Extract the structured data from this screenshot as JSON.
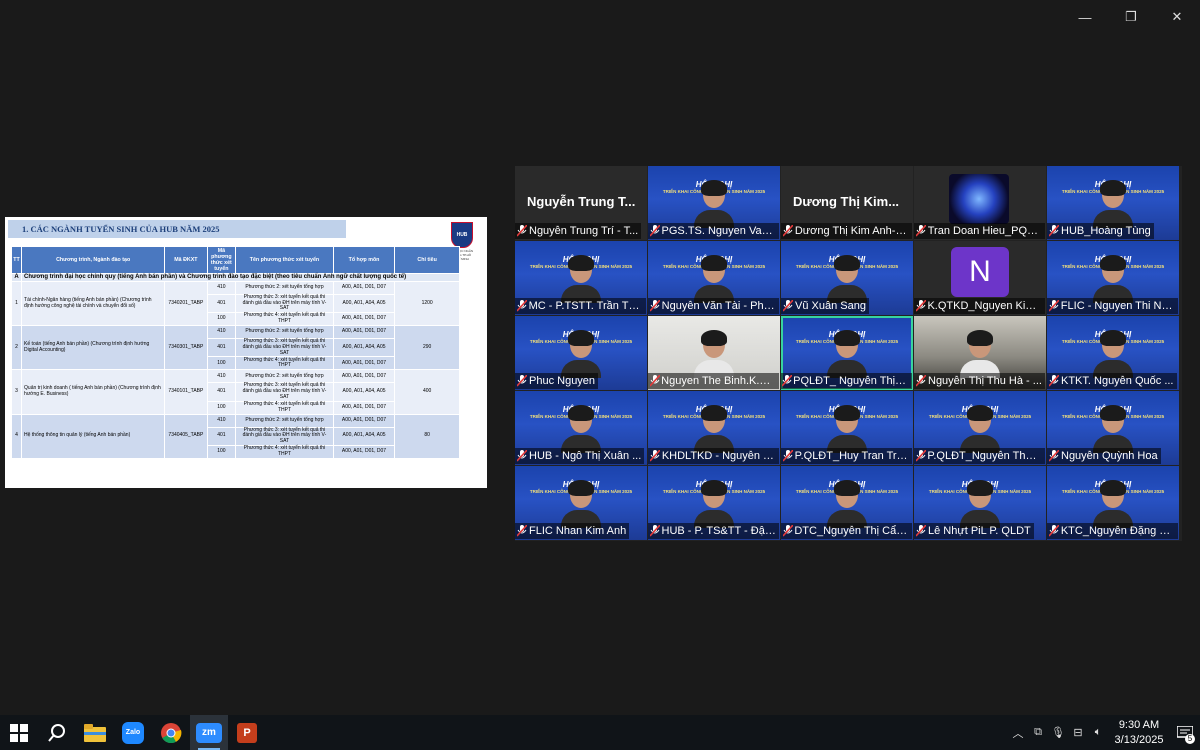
{
  "window": {
    "minimize_label": "—",
    "restore_label": "❐",
    "close_label": "✕"
  },
  "slide": {
    "title": "1. CÁC NGÀNH TUYỂN SINH CỦA HUB NĂM 2025",
    "logo_text": "HUB",
    "logo_caption": "ĐẠI HỌC NGÂN HÀNG TP.HỒ CHÍ MINH",
    "headers": [
      "TT",
      "Chương trình, Ngành đào tạo",
      "Mã ĐKXT",
      "Mã phương thức xét tuyển",
      "Tên phương thức xét tuyển",
      "Tổ hợp môn",
      "Chỉ tiêu"
    ],
    "section_no": "A",
    "section_title": "Chương trình đại học chính quy (tiếng Anh bán phần) và Chương trình đào tạo đặc biệt (theo tiêu chuẩn Anh ngữ chất lượng quốc tế)",
    "programs": [
      {
        "tt": "1",
        "name": "Tài chính-Ngân hàng (tiếng Anh bán phần) (Chương trình định hướng công nghệ tài chính và chuyển đổi số)",
        "code": "7340201_TABP",
        "quota": "1200"
      },
      {
        "tt": "2",
        "name": "Kế toán (tiếng Anh bán phần) (Chương trình định hướng Digital Accounting)",
        "code": "7340301_TABP",
        "quota": "290"
      },
      {
        "tt": "3",
        "name": "Quản trị kinh doanh ( tiếng Anh bán phần) (Chương trình định hướng E. Business)",
        "code": "7340101_TABP",
        "quota": "400"
      },
      {
        "tt": "4",
        "name": "Hệ thống thông tin quản lý (tiếng Anh bán phần)",
        "code": "7340405_TABP",
        "quota": "80"
      }
    ],
    "methods": [
      {
        "code": "410",
        "name": "Phương thức 2: xét tuyển tổng hợp",
        "combo": "A00, A01, D01, D07"
      },
      {
        "code": "401",
        "name": "Phương thức 3: xét tuyển kết quả thi đánh giá đầu vào ĐH trên máy tính V-SAT",
        "combo": "A00, A01, A04, A05"
      },
      {
        "code": "100",
        "name": "Phương thức 4: xét tuyển kết quả thi THPT",
        "combo": "A00, A01, D01, D07"
      }
    ]
  },
  "gallery": {
    "tiles": [
      {
        "name": "Nguyễn Trung Trí - T...",
        "big": "Nguyễn Trung T...",
        "kind": "dark"
      },
      {
        "name": "PGS.TS. Nguyen Van ...",
        "kind": "blue"
      },
      {
        "name": "Dương Thị Kim Anh-k...",
        "big": "Dương Thị Kim...",
        "kind": "dark"
      },
      {
        "name": "Tran Doan Hieu_PQC...",
        "kind": "spark"
      },
      {
        "name": "HUB_Hoàng Tùng",
        "kind": "blue"
      },
      {
        "name": "MC - P.TSTT. Trần Thị...",
        "kind": "blue"
      },
      {
        "name": "Nguyễn Văn Tài - Phò...",
        "kind": "blue"
      },
      {
        "name": "Vũ Xuân Sang",
        "kind": "blue"
      },
      {
        "name": "K.QTKD_Nguyen Kim ...",
        "kind": "avatar",
        "initial": "N"
      },
      {
        "name": "FLIC - Nguyen Thi Ng...",
        "kind": "blue"
      },
      {
        "name": "Phuc Nguyen",
        "kind": "blue"
      },
      {
        "name": "Nguyen The Binh.K.TC...",
        "kind": "white"
      },
      {
        "name": "PQLĐT_ Nguyễn Thị Huỳ...",
        "kind": "blue"
      },
      {
        "name": "Nguyễn Thị Thu Hà - ...",
        "kind": "room"
      },
      {
        "name": "KTKT. Nguyễn Quốc ...",
        "kind": "blue"
      },
      {
        "name": "HUB - Ngô Thị Xuân ...",
        "kind": "blue"
      },
      {
        "name": "KHDLTKD - Nguyễn T...",
        "kind": "blue"
      },
      {
        "name": "P.QLĐT_Huy Tran Tro...",
        "kind": "blue"
      },
      {
        "name": "P.QLĐT_Nguyễn Than...",
        "kind": "blue"
      },
      {
        "name": "Nguyễn Quỳnh Hoa",
        "kind": "blue"
      },
      {
        "name": "FLIC Nhan Kim Anh",
        "kind": "blue"
      },
      {
        "name": "HUB - P. TS&TT - Đậu...",
        "kind": "blue"
      },
      {
        "name": "DTC_Nguyễn Thị Cẩm...",
        "kind": "blue"
      },
      {
        "name": "Lê Nhựt PiL P. QLDT",
        "kind": "blue"
      },
      {
        "name": "KTC_Nguyễn Đặng H...",
        "kind": "blue"
      }
    ],
    "banner_title": "HỘI NGHỊ",
    "banner_sub": "TRIỂN KHAI CÔNG TÁC TUYỂN SINH NĂM 2025"
  },
  "taskbar": {
    "time": "9:30 AM",
    "date": "3/13/2025",
    "zoom_label": "zm",
    "zalo_label": "Zalo",
    "notif_count": "5"
  },
  "colors": {
    "accent": "#38d39f",
    "slide_header": "#4a78c0",
    "tile_blue": "#2852c4",
    "muted_mic": "#e23b3b"
  }
}
